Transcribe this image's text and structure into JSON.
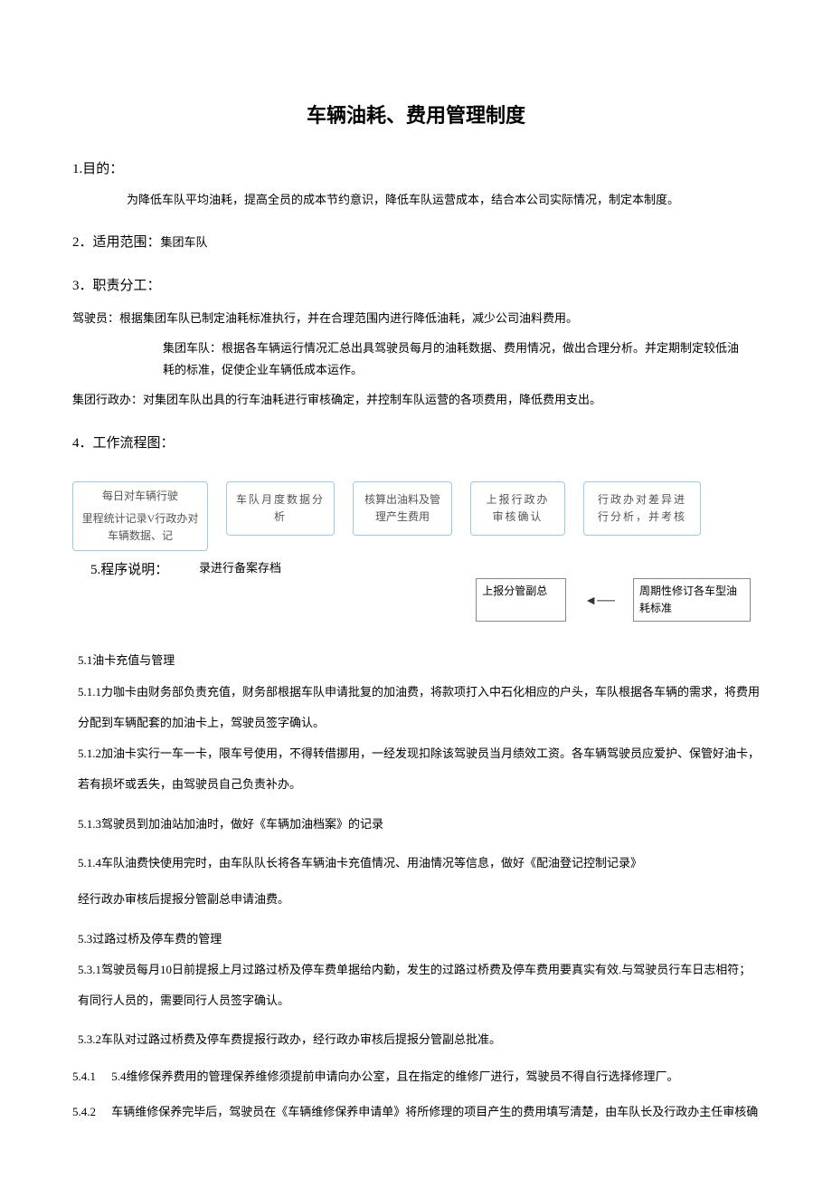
{
  "title": "车辆油耗、费用管理制度",
  "s1": {
    "head": "1.目的：",
    "body": "为降低车队平均油耗，提高全员的成本节约意识，降低车队运营成本，结合本公司实际情况，制定本制度。"
  },
  "s2": {
    "head": "2．适用范围：",
    "tail": "集团车队"
  },
  "s3": {
    "head": "3．职责分工：",
    "p1": "驾驶员：根据集团车队已制定油耗标准执行，并在合理范围内进行降低油耗，减少公司油料费用。",
    "p2": "集团车队：根据各车辆运行情况汇总出具驾驶员每月的油耗数据、费用情况，做出合理分析。并定期制定较低油耗的标准，促使企业车辆低成本运作。",
    "p3": "集团行政办：对集团车队出具的行车油耗进行审核确定，并控制车队运营的各项费用，降低费用支出。"
  },
  "s4": {
    "head": "4．工作流程图："
  },
  "flow": {
    "b1a": "每日对车辆行驶",
    "b1b": "里程统计记录V行政办对车辆数据、记",
    "b2": "车队月度数据分析",
    "b3": "核算出油料及管理产生费用",
    "b4": "上报行政办审核确认",
    "b5": "行政办对差异进行分析，并考核",
    "mid_left": "5.程序说明：",
    "mid_right": "录进行备案存档",
    "b6": "上报分管副总",
    "b7": "周期性修订各车型油耗标准"
  },
  "s5": {
    "h51": "5.1油卡充值与管理",
    "p511": "5.1.1力咖卡由财务部负责充值，财务部根据车队申请批复的加油费，将款项打入中石化相应的户头，车队根据各车辆的需求，将费用分配到车辆配套的加油卡上，驾驶员签字确认。",
    "p512": "5.1.2加油卡实行一车一卡，限车号使用，不得转借挪用，一经发现扣除该驾驶员当月绩效工资。各车辆驾驶员应爱护、保管好油卡，若有损坏或丢失，由驾驶员自己负责补办。",
    "p513": "5.1.3驾驶员到加油站加油时，做好《车辆加油档案》的记录",
    "p514": "5.1.4车队油费快使用完时，由车队队长将各车辆油卡充值情况、用油情况等信息，做好《配油登记控制记录》",
    "p51x": "经行政办审核后提报分管副总申请油费。",
    "h53": "5.3过路过桥及停车费的管理",
    "p531": "5.3.1驾驶员每月10日前提报上月过路过桥及停车费单据给内勤，发生的过路过桥费及停车费用要真实有效.与驾驶员行车日志相符；有同行人员的，需要同行人员签字确认。",
    "p532": "5.3.2车队对过路过桥费及停车费提报行政办，经行政办审核后提报分管副总批准。",
    "n541": "5.4.1",
    "p541": "5.4维修保养费用的管理保养维修须提前申请向办公室，且在指定的维修厂进行，驾驶员不得自行选择修理厂。",
    "n542": "5.4.2",
    "p542": "车辆维修保养完毕后，驾驶员在《车辆维修保养申请单》将所修理的项目产生的费用填写清楚，由车队长及行政办主任审核确"
  }
}
